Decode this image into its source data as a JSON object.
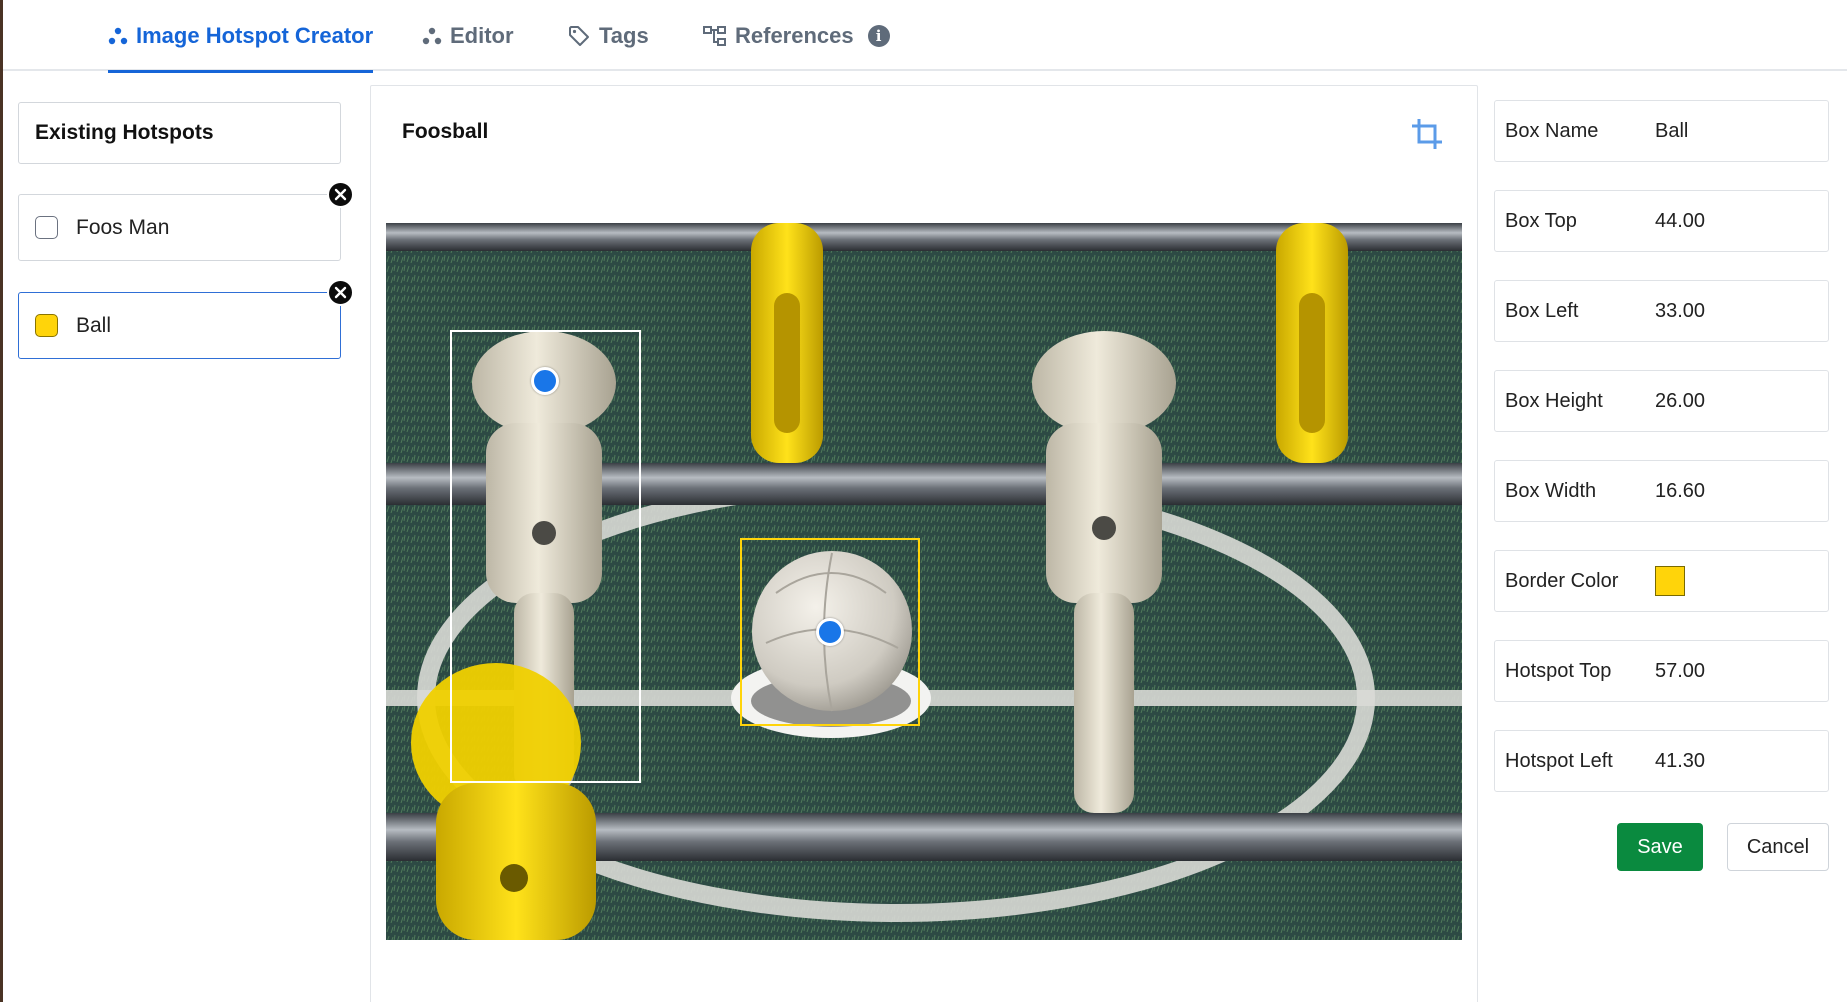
{
  "tabs": [
    {
      "label": "Image Hotspot Creator",
      "icon": "hotspot-creator-icon",
      "active": true
    },
    {
      "label": "Editor",
      "icon": "editor-icon",
      "active": false
    },
    {
      "label": "Tags",
      "icon": "tag-icon",
      "active": false
    },
    {
      "label": "References",
      "icon": "references-icon",
      "active": false
    }
  ],
  "references_info_glyph": "i",
  "hotspots": {
    "header": "Existing Hotspots",
    "items": [
      {
        "label": "Foos Man",
        "checked": false
      },
      {
        "label": "Ball",
        "checked": true,
        "color": "#FFD40A"
      }
    ]
  },
  "image": {
    "title": "Foosball",
    "crop_icon": "crop-icon"
  },
  "properties": [
    {
      "label": "Box Name",
      "value": "Ball"
    },
    {
      "label": "Box Top",
      "value": "44.00"
    },
    {
      "label": "Box Left",
      "value": "33.00"
    },
    {
      "label": "Box Height",
      "value": "26.00"
    },
    {
      "label": "Box Width",
      "value": "16.60"
    },
    {
      "label": "Border Color",
      "value": ""
    },
    {
      "label": "Hotspot Top",
      "value": "57.00"
    },
    {
      "label": "Hotspot Left",
      "value": "41.30"
    }
  ],
  "border_color": "#FFD40A",
  "actions": {
    "save": "Save",
    "cancel": "Cancel"
  },
  "colors": {
    "accent": "#1565D8",
    "save": "#0A8A3F",
    "hotspot_dot": "#1976E8",
    "foos_man_box": "#FFFFFF",
    "ball_box": "#FFD40A"
  }
}
